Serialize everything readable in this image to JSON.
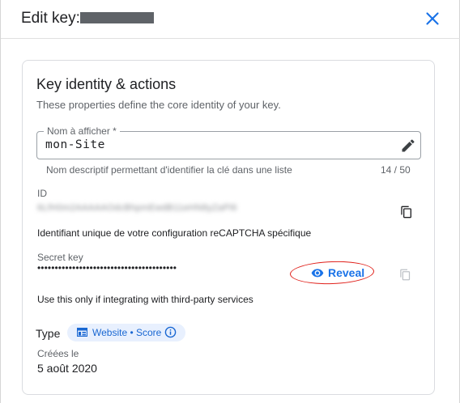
{
  "dialog": {
    "title": "Edit key:",
    "close_icon": "close-icon"
  },
  "card": {
    "title": "Key identity & actions",
    "subtitle": "These properties define the core identity of your key."
  },
  "name_field": {
    "label": "Nom à afficher *",
    "value": "mon-Site",
    "hint": "Nom descriptif permettant d'identifier la clé dans une liste",
    "counter": "14 / 50",
    "edit_icon": "pencil-icon"
  },
  "id_section": {
    "label": "ID",
    "value": "6LfH0m2AAAAAOdcBhpmEwdB11eHN8yZaPl6",
    "description": "Identifiant unique de votre configuration reCAPTCHA spécifique",
    "copy_icon": "copy-icon"
  },
  "secret_section": {
    "label": "Secret key",
    "masked_value": "••••••••••••••••••••••••••••••••••••••••",
    "reveal_label": "Reveal",
    "reveal_icon": "eye-icon",
    "description": "Use this only if integrating with third-party services",
    "copy_icon": "copy-icon"
  },
  "type_section": {
    "label": "Type",
    "chip_label": "Website • Score",
    "chip_icon": "web-icon",
    "info_icon": "info-icon"
  },
  "created_section": {
    "label": "Créées le",
    "date": "5 août 2020"
  },
  "colors": {
    "accent": "#1a73e8",
    "annotation": "#e0201a",
    "chip_bg": "#e8f0fe"
  }
}
